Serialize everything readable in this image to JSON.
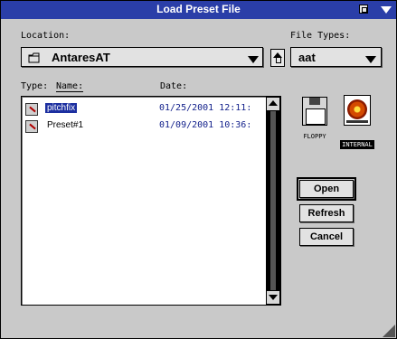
{
  "window": {
    "title": "Load Preset File"
  },
  "location": {
    "label": "Location:",
    "value": "AntaresAT",
    "icon": "folder-icon"
  },
  "file_types": {
    "label": "File Types:",
    "value": "aat"
  },
  "columns": {
    "type": "Type:",
    "name": "Name:",
    "date": "Date:"
  },
  "files": [
    {
      "name": "pitchfix",
      "date": "01/25/2001  12:11:",
      "selected": true,
      "icon": "document-icon"
    },
    {
      "name": "Preset#1",
      "date": "01/09/2001  10:36:",
      "selected": false,
      "icon": "document-icon"
    }
  ],
  "volumes": [
    {
      "label": "FLOPPY",
      "icon": "floppy-disk-icon"
    },
    {
      "label": "INTERNAL",
      "icon": "hard-drive-icon"
    }
  ],
  "buttons": {
    "open": "Open",
    "refresh": "Refresh",
    "cancel": "Cancel"
  },
  "colors": {
    "titlebar": "#2a3ea8",
    "selection": "#1c2fa0",
    "date_text": "#14228c"
  }
}
